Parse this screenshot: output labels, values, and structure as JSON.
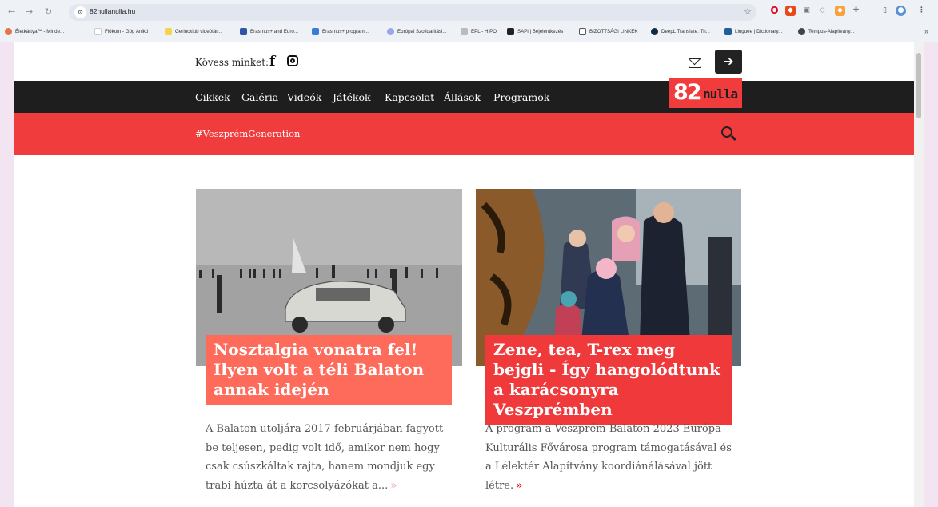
{
  "browser": {
    "url": "82nullanulla.hu",
    "bookmarks": [
      "Életkártya™ - Minde...",
      "Fiókom - Góg Anikó",
      "Gerincklub videótár...",
      "Erasmus+ and Euro...",
      "Erasmus+ program...",
      "Európai Szolidaritási...",
      "EPL - HIPO",
      "SAPi | Bejelentkezés",
      "BIZOTTSÁGI LINKEK",
      "DeepL Translate: Th...",
      "Linguee | Dictionary...",
      "Tempus-Alapítvány..."
    ],
    "more": "»"
  },
  "header": {
    "follow_label": "Kövess minket:",
    "facebook_glyph": "f",
    "login_glyph": "➔"
  },
  "nav": {
    "items": [
      "Cikkek",
      "Galéria",
      "Videók",
      "Játékok",
      "Kapcsolat",
      "Állások",
      "Programok"
    ],
    "logo_number": "82",
    "logo_word": "nulla"
  },
  "subnav": {
    "hashtag": "#VeszprémGeneration"
  },
  "articles": [
    {
      "title": "Nosztalgia vonatra fel! Ilyen volt a téli Balaton annak idején",
      "excerpt": "A Balaton utoljára 2017 februárjában fagyott be teljesen, pedig volt idő, amikor nem hogy csak csúszkáltak rajta, hanem mondjuk egy trabi húzta át a korcsolyázókat a...",
      "more": "»"
    },
    {
      "title": "Zene, tea, T-rex meg bejgli - Így hangolódtunk a karácsonyra Veszprémben",
      "excerpt": "A program a Veszprém-Balaton 2023 Európa Kulturális Fővárosa program támogatásával és a Lélektér Alapítvány koordiánálásával jött létre.",
      "more": "»"
    }
  ],
  "colors": {
    "brand_red": "#f03c3c",
    "nav_dark": "#1e1e1e",
    "card_title_light": "#ff6b5b"
  }
}
